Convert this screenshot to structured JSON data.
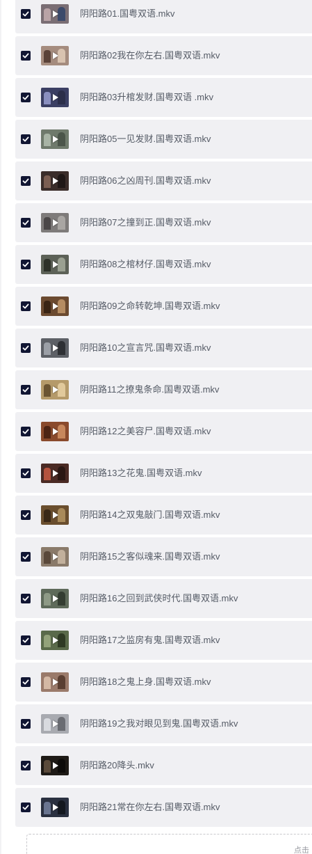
{
  "files": [
    {
      "name": "阴阳路01.国粤双语.mkv",
      "checked": true,
      "thumb": [
        "#7a6e74",
        "#b9a3a6",
        "#3c4a6a"
      ]
    },
    {
      "name": "阴阳路02我在你左右.国粤双语.mkv",
      "checked": true,
      "thumb": [
        "#a58c7e",
        "#5a4238",
        "#d9c3b0"
      ]
    },
    {
      "name": "阴阳路03升棺发财.国粤双语 .mkv",
      "checked": true,
      "thumb": [
        "#3b3f63",
        "#8a8fbf",
        "#2c2f4a"
      ]
    },
    {
      "name": "阴阳路05一见发财.国粤双语.mkv",
      "checked": true,
      "thumb": [
        "#6f7a6c",
        "#a8b4a5",
        "#4b554a"
      ]
    },
    {
      "name": "阴阳路06之凶周刊.国粤双语.mkv",
      "checked": true,
      "thumb": [
        "#3a2d2a",
        "#7b5e52",
        "#1f1817"
      ]
    },
    {
      "name": "阴阳路07之撞到正.国粤双语.mkv",
      "checked": true,
      "thumb": [
        "#7e7b7a",
        "#4a4647",
        "#a9a6a3"
      ]
    },
    {
      "name": "阴阳路08之棺材仔.国粤双语.mkv",
      "checked": true,
      "thumb": [
        "#5c6157",
        "#2d3129",
        "#9aa091"
      ]
    },
    {
      "name": "阴阳路09之命转乾坤.国粤双语.mkv",
      "checked": true,
      "thumb": [
        "#6b4a30",
        "#3a2414",
        "#b58c62"
      ]
    },
    {
      "name": "阴阳路10之宣言咒.国粤双语.mkv",
      "checked": true,
      "thumb": [
        "#5d6066",
        "#9b9fa6",
        "#2e3034"
      ]
    },
    {
      "name": "阴阳路11之撩鬼条命.国粤双语.mkv",
      "checked": true,
      "thumb": [
        "#b59a6a",
        "#6b5432",
        "#e1c99b"
      ]
    },
    {
      "name": "阴阳路12之美容尸.国粤双语.mkv",
      "checked": true,
      "thumb": [
        "#8a4a2c",
        "#4d2414",
        "#c7875c"
      ]
    },
    {
      "name": "阴阳路13之花鬼.国粤双语.mkv",
      "checked": true,
      "thumb": [
        "#4a2a24",
        "#b5533e",
        "#2a1713"
      ]
    },
    {
      "name": "阴阳路14之双鬼敲门.国粤双语.mkv",
      "checked": true,
      "thumb": [
        "#6a4e2e",
        "#3a2816",
        "#a98a5a"
      ]
    },
    {
      "name": "阴阳路15之客似魂来.国粤双语.mkv",
      "checked": true,
      "thumb": [
        "#8a7a6a",
        "#5a483a",
        "#c2b09c"
      ]
    },
    {
      "name": "阴阳路16之回到武侠时代.国粤双语.mkv",
      "checked": true,
      "thumb": [
        "#5e6a5a",
        "#8e9a86",
        "#343d32"
      ]
    },
    {
      "name": "阴阳路17之监房有鬼.国粤双语.mkv",
      "checked": true,
      "thumb": [
        "#5a6a4a",
        "#93a27a",
        "#2f3a24"
      ]
    },
    {
      "name": "阴阳路18之鬼上身.国粤双语.mkv",
      "checked": true,
      "thumb": [
        "#9a7a6a",
        "#d4b8a4",
        "#5a3f32"
      ]
    },
    {
      "name": "阴阳路19之我对眼见到鬼.国粤双语.mkv",
      "checked": true,
      "thumb": [
        "#a8aab0",
        "#d8dadf",
        "#6a6c72"
      ]
    },
    {
      "name": "阴阳路20降头.mkv",
      "checked": true,
      "thumb": [
        "#1e1a16",
        "#5a4a3a",
        "#0e0c0a"
      ]
    },
    {
      "name": "阴阳路21常在你左右.国粤双语.mkv",
      "checked": true,
      "thumb": [
        "#2a3040",
        "#6a7590",
        "#141820"
      ]
    }
  ],
  "upload": {
    "hint": "点击"
  },
  "colors": {
    "checkbox": "#111633",
    "row_bg": "#f0f0f3",
    "text": "#555b66"
  }
}
